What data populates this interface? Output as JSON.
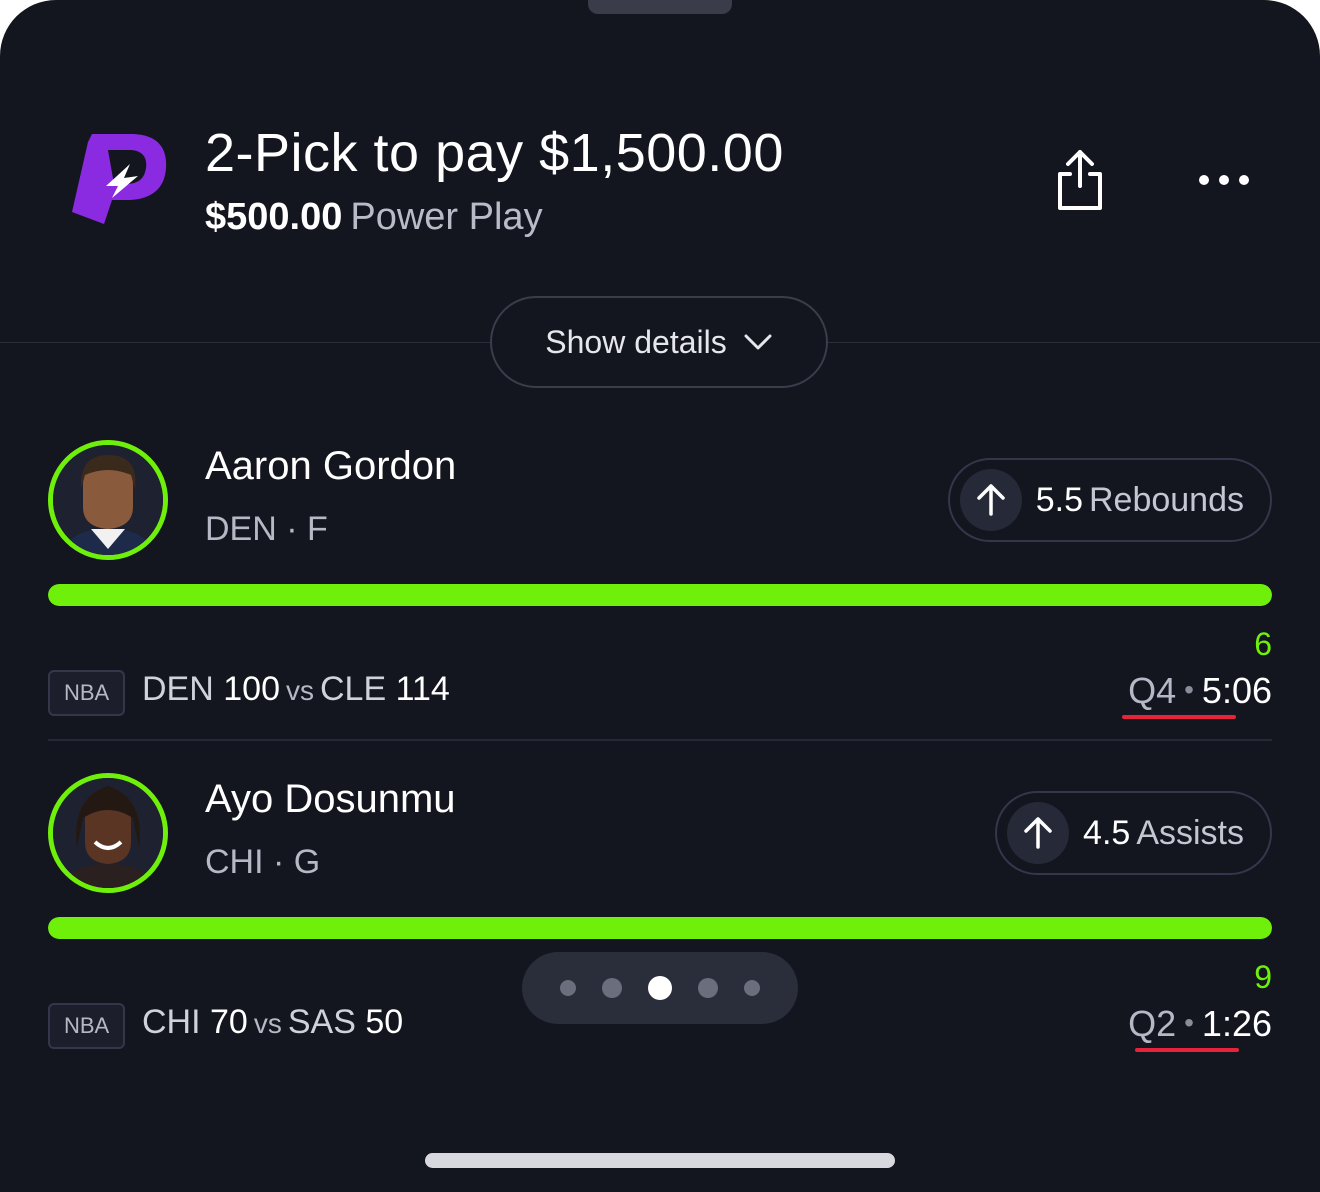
{
  "header": {
    "title": "2-Pick to pay $1,500.00",
    "entry_amount": "$500.00",
    "play_type": "Power Play",
    "logo_icon": "prizepicks-logo-icon",
    "share_icon": "share-icon",
    "more_icon": "more-icon"
  },
  "show_details": {
    "label": "Show details",
    "icon": "chevron-down-icon"
  },
  "picks": [
    {
      "player": "Aaron Gordon",
      "team_pos": "DEN · F",
      "line": "5.5",
      "stat": "Rebounds",
      "direction_icon": "arrow-up-icon",
      "progress": 1.0,
      "actual": "6",
      "league": "NBA",
      "team1": "DEN",
      "score1": "100",
      "vs": "vs",
      "team2": "CLE",
      "score2": "114",
      "quarter": "Q4",
      "clock": "5:06"
    },
    {
      "player": "Ayo Dosunmu",
      "team_pos": "CHI · G",
      "line": "4.5",
      "stat": "Assists",
      "direction_icon": "arrow-up-icon",
      "progress": 1.0,
      "actual": "9",
      "league": "NBA",
      "team1": "CHI",
      "score1": "70",
      "vs": "vs",
      "team2": "SAS",
      "score2": "50",
      "quarter": "Q2",
      "clock": "1:26"
    }
  ],
  "pager": {
    "count": 5,
    "active_index": 2
  },
  "colors": {
    "background": "#13151f",
    "accent_green": "#6ff00a",
    "brand_purple": "#8a2be2",
    "underline_red": "#e5233a"
  }
}
